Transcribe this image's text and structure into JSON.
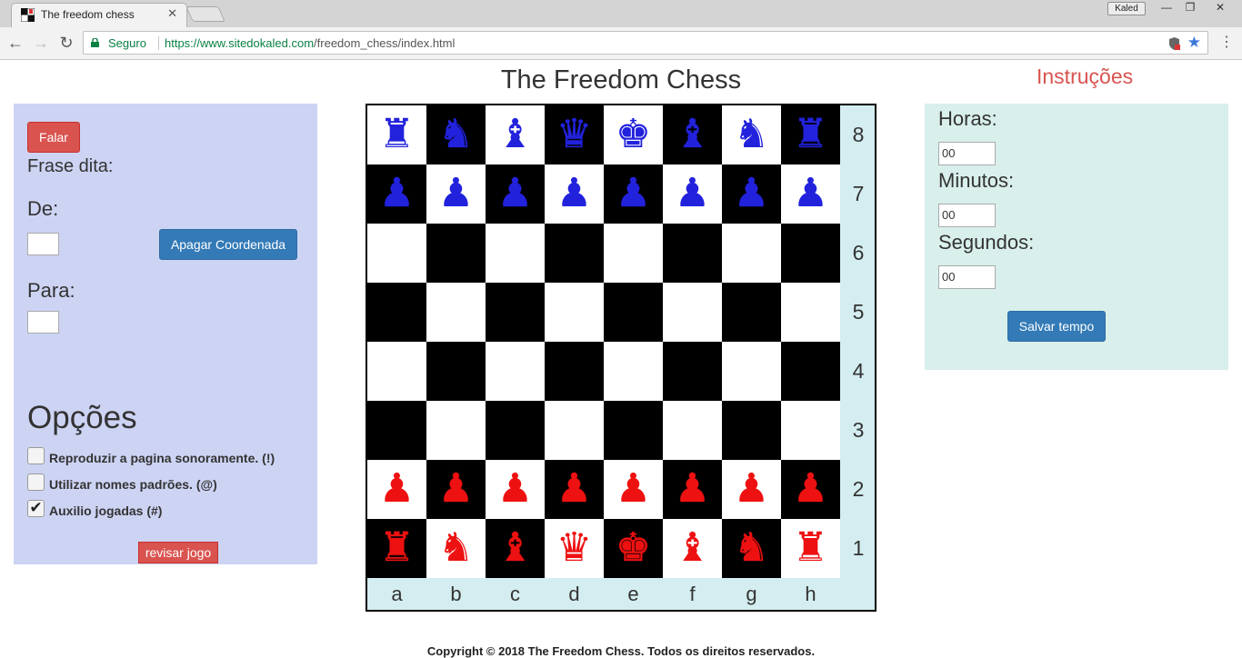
{
  "browser": {
    "tab_title": "The freedom chess",
    "tab_close": "✕",
    "profile_name": "Kaled",
    "window_minimize": "—",
    "window_restore": "❐",
    "window_close": "✕",
    "back": "←",
    "forward": "→",
    "reload": "↻",
    "secure_label": "Seguro",
    "url_host": "https://www.sitedokaled.com",
    "url_path": "/freedom_chess/index.html",
    "star": "★",
    "menu": "⋮"
  },
  "page": {
    "title": "The Freedom Chess",
    "instructions_link": "Instruções",
    "footer": "Copyright © 2018 The Freedom Chess. Todos os direitos reservados."
  },
  "left_panel": {
    "speak_button": "Falar",
    "spoken_phrase_label": "Frase dita:",
    "from_label": "De:",
    "clear_button": "Apagar Coordenada",
    "to_label": "Para:",
    "options_title": "Opções",
    "options": [
      {
        "label": "Reproduzir a pagina sonoramente. (!)",
        "checked": false
      },
      {
        "label": "Utilizar nomes padrões. (@)",
        "checked": false
      },
      {
        "label": "Auxilio jogadas (#)",
        "checked": true
      }
    ],
    "review_button": "revisar jogo"
  },
  "right_panel": {
    "hours_label": "Horas:",
    "hours_value": "00",
    "minutes_label": "Minutos:",
    "minutes_value": "00",
    "seconds_label": "Segundos:",
    "seconds_value": "00",
    "save_button": "Salvar tempo"
  },
  "board": {
    "files": [
      "a",
      "b",
      "c",
      "d",
      "e",
      "f",
      "g",
      "h"
    ],
    "ranks": [
      "8",
      "7",
      "6",
      "5",
      "4",
      "3",
      "2",
      "1"
    ],
    "colors": {
      "top_side": "#2222dd",
      "bottom_side": "#ee1111",
      "light_square": "#ffffff",
      "dark_square": "#000000"
    },
    "position": [
      [
        "♜",
        "♞",
        "♝",
        "♛",
        "♚",
        "♝",
        "♞",
        "♜"
      ],
      [
        "♟",
        "♟",
        "♟",
        "♟",
        "♟",
        "♟",
        "♟",
        "♟"
      ],
      [
        "",
        "",
        "",
        "",
        "",
        "",
        "",
        ""
      ],
      [
        "",
        "",
        "",
        "",
        "",
        "",
        "",
        ""
      ],
      [
        "",
        "",
        "",
        "",
        "",
        "",
        "",
        ""
      ],
      [
        "",
        "",
        "",
        "",
        "",
        "",
        "",
        ""
      ],
      [
        "♟",
        "♟",
        "♟",
        "♟",
        "♟",
        "♟",
        "♟",
        "♟"
      ],
      [
        "♜",
        "♞",
        "♝",
        "♛",
        "♚",
        "♝",
        "♞",
        "♜"
      ]
    ]
  }
}
